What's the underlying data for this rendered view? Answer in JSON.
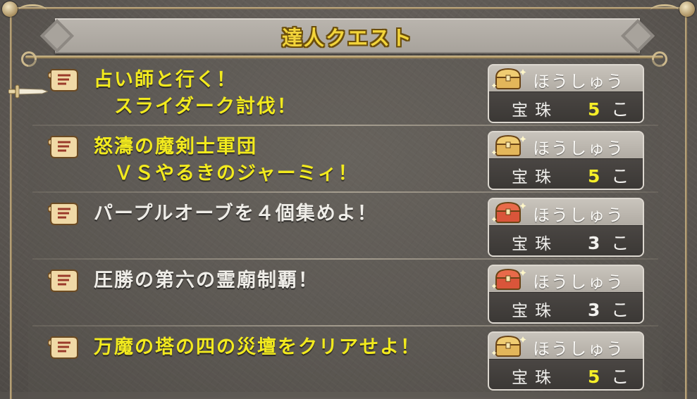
{
  "title": "達人クエスト",
  "reward_label": "ほうしゅう",
  "reward_unit": "こ",
  "colors": {
    "completed_text": "#f2ea1e",
    "pending_text": "#efede8",
    "title_text": "#f2d43a"
  },
  "icons": {
    "quest": "scroll-icon",
    "reward_gold": "treasure-chest-icon",
    "reward_red": "treasure-chest-red-icon",
    "cursor": "sword-cursor-icon"
  },
  "quests": [
    {
      "name": "占い師と行く！\n　スライダーク討伐！",
      "state": "yellow",
      "chest": "gold",
      "reward_item": "宝珠",
      "reward_count": "5",
      "selected": true
    },
    {
      "name": "怒濤の魔剣士軍団\n　ＶＳやるきのジャーミィ！",
      "state": "yellow",
      "chest": "gold",
      "reward_item": "宝珠",
      "reward_count": "5",
      "selected": false
    },
    {
      "name": "パープルオーブを４個集めよ！",
      "state": "white",
      "chest": "red",
      "reward_item": "宝珠",
      "reward_count": "3",
      "selected": false
    },
    {
      "name": "圧勝の第六の霊廟制覇！",
      "state": "white",
      "chest": "red",
      "reward_item": "宝珠",
      "reward_count": "3",
      "selected": false
    },
    {
      "name": "万魔の塔の四の災壇をクリアせよ！",
      "state": "yellow",
      "chest": "gold",
      "reward_item": "宝珠",
      "reward_count": "5",
      "selected": false
    }
  ]
}
